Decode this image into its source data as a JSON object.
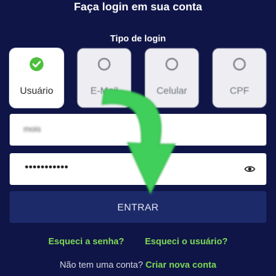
{
  "header": {
    "title": "Faça login em sua conta",
    "login_type_label": "Tipo de login"
  },
  "login_types": [
    {
      "label": "Usuário",
      "selected": true
    },
    {
      "label": "E-Mail",
      "selected": false
    },
    {
      "label": "Celular",
      "selected": false
    },
    {
      "label": "CPF",
      "selected": false
    }
  ],
  "form": {
    "username_value": "mois",
    "password_value": "•••••••••••",
    "submit_label": "ENTRAR"
  },
  "links": {
    "forgot_password": "Esqueci a senha?",
    "forgot_username": "Esqueci o usuário?"
  },
  "footer": {
    "no_account_text": "Não tem uma conta?",
    "create_account": "Criar nova conta"
  },
  "icons": {
    "selected_check": "check-circle-icon",
    "radio_empty": "radio-empty-icon",
    "password_toggle": "eye-icon",
    "overlay": "curved-arrow-down-icon"
  },
  "colors": {
    "background": "#0f1547",
    "button": "#1d2a6a",
    "accent_green": "#7ed957",
    "check_green": "#4bbf3a",
    "arrow_green": "#3fcf5a"
  }
}
